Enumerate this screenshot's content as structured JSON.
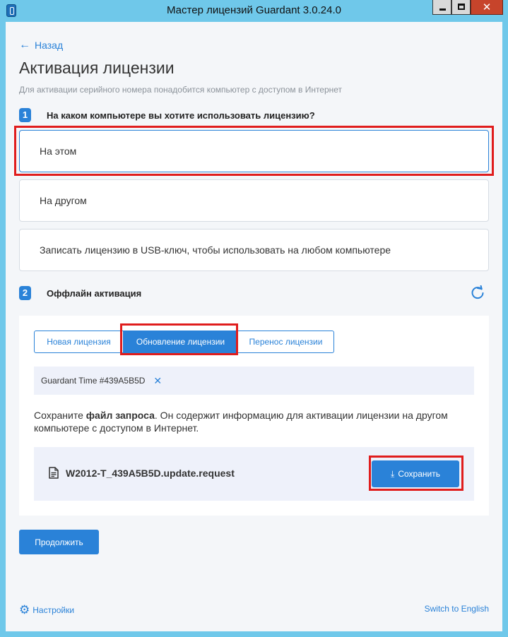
{
  "window": {
    "title": "Мастер лицензий Guardant 3.0.24.0",
    "min_glyph": "",
    "close_glyph": "✕"
  },
  "nav": {
    "back_label": "Назад",
    "back_arrow": "←"
  },
  "page": {
    "title": "Активация лицензии",
    "subtitle": "Для активации серийного номера понадобится компьютер с доступом в Интернет"
  },
  "step1": {
    "number": "1",
    "title": "На каком компьютере вы хотите использовать лицензию?",
    "options": [
      {
        "label": "На этом",
        "selected": true
      },
      {
        "label": "На другом",
        "selected": false
      },
      {
        "label": "Записать лицензию в USB-ключ, чтобы использовать на любом компьютере",
        "selected": false
      }
    ]
  },
  "step2": {
    "number": "2",
    "title": "Оффлайн активация",
    "tabs": [
      {
        "label": "Новая лицензия",
        "active": false
      },
      {
        "label": "Обновление лицензии",
        "active": true
      },
      {
        "label": "Перенос лицензии",
        "active": false
      }
    ],
    "key_chip": {
      "label": "Guardant Time #439A5B5D",
      "remove_glyph": "✕"
    },
    "desc_pre": "Сохраните ",
    "desc_bold": "файл запроса",
    "desc_post": ". Он содержит информацию для активации лицензии на другом компьютере с доступом в Интернет.",
    "file_name": "W2012-T_439A5B5D.update.request",
    "save_label": "Сохранить",
    "save_glyph": "⤓"
  },
  "footer": {
    "continue_label": "Продолжить",
    "settings_label": "Настройки",
    "settings_glyph": "⚙",
    "language_label": "Switch to English"
  },
  "colors": {
    "accent": "#2a82d8",
    "highlight_frame": "#e01d1d",
    "titlebar": "#6fc8ea",
    "close_button": "#c7442b"
  },
  "icons": {
    "app": "guardant-key-icon",
    "back": "arrow-left-icon",
    "refresh": "refresh-icon",
    "file": "file-text-icon",
    "save": "download-icon",
    "settings": "gear-icon",
    "chip_remove": "close-icon"
  }
}
